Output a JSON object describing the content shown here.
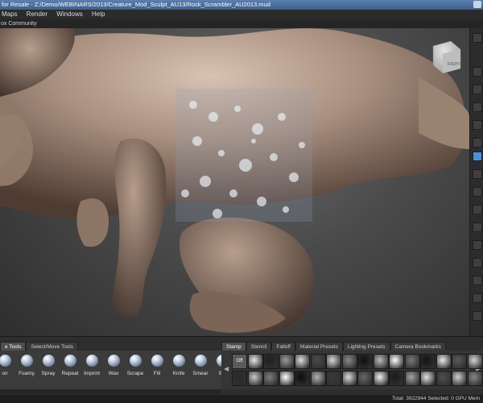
{
  "titlebar": {
    "title": "for Resale - Z:/Demo/WEBINARS/2013/Creature_Mod_Sculpt_AU13/Rock_Scrambler_AU2013.mud"
  },
  "menu": {
    "items": [
      "Maps",
      "Render",
      "Windows",
      "Help"
    ]
  },
  "shelf": {
    "label": "ox Community"
  },
  "viewcube": {
    "face_label": "RIGHT"
  },
  "tray": {
    "tabs_left": [
      {
        "label": "e Tools",
        "active": true
      },
      {
        "label": "Select/Move Tools",
        "active": false
      }
    ],
    "tools": [
      "on",
      "Foamy",
      "Spray",
      "Repeat",
      "Imprint",
      "Wax",
      "Scrape",
      "Fill",
      "Knife",
      "Smear",
      "Bu"
    ],
    "tabs_right": [
      {
        "label": "Stamp",
        "active": true
      },
      {
        "label": "Stencil",
        "active": false
      },
      {
        "label": "Falloff",
        "active": false
      },
      {
        "label": "Material Presets",
        "active": false
      },
      {
        "label": "Lighting Presets",
        "active": false
      },
      {
        "label": "Camera Bookmarks",
        "active": false
      }
    ],
    "stamp_off_label": "Off",
    "stamp_colors": [
      "#e8e8e8",
      "#202020",
      "#9a9a9a",
      "#e0e0e0",
      "#4a4a4a",
      "#d8d8d8",
      "#888",
      "#101010",
      "#bbbbbb",
      "#ffffff",
      "#777",
      "#141414",
      "#ececec",
      "#5a5a5a",
      "#d6d6d6",
      "#2a2a2a",
      "#c7c7c7",
      "#7d7d7d",
      "#ffffff",
      "#0c0c0c",
      "#b2b2b2",
      "#3a3a3a",
      "#dcdcdc",
      "#666",
      "#f0f0f0",
      "#1a1a1a",
      "#a5a5a5",
      "#e3e3e3",
      "#4f4f4f",
      "#cfcfcf",
      "#878787",
      "#f4f4f4",
      "#9ab24a",
      "#cfcfcf",
      "#6e8f3a",
      "#eaeaea",
      "#4e7a2a",
      "#a8a8a8",
      "#3b6b22",
      "#dadada",
      "#8a9b4f",
      "#b58a3a",
      "#efefef",
      "#8a6a3a",
      "#d9c27a",
      "#ffffff"
    ]
  },
  "status": {
    "text": "Total: 3922944   Selected: 0   GPU Mem"
  },
  "colors": {
    "skin": "#a88f7f",
    "active_blue": "#4a90d9"
  }
}
